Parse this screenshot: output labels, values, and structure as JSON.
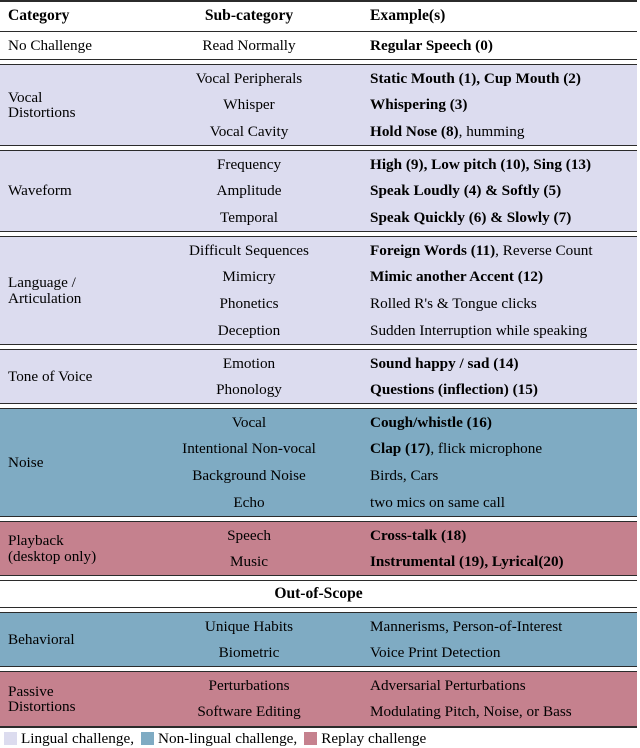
{
  "table": {
    "headers": {
      "category": "Category",
      "subcategory": "Sub-category",
      "examples": "Example(s)"
    },
    "scope_divider": "Out-of-Scope",
    "groups": [
      {
        "id": "no-challenge",
        "band": "white",
        "category": [
          "No Challenge"
        ],
        "rows": [
          {
            "sub": "Read Normally",
            "example_bold": "Regular Speech (0)",
            "example_rest": ""
          }
        ]
      },
      {
        "id": "vocal-distortions",
        "band": "lilac",
        "category": [
          "Vocal",
          "Distortions"
        ],
        "rows": [
          {
            "sub": "Vocal Peripherals",
            "example_bold": "Static Mouth (1), Cup Mouth (2)",
            "example_rest": ""
          },
          {
            "sub": "Whisper",
            "example_bold": "Whispering (3)",
            "example_rest": ""
          },
          {
            "sub": "Vocal Cavity",
            "example_bold": "Hold Nose (8)",
            "example_rest": ", humming"
          }
        ]
      },
      {
        "id": "waveform",
        "band": "lilac",
        "category": [
          "Waveform"
        ],
        "rows": [
          {
            "sub": "Frequency",
            "example_bold": "High (9), Low pitch (10), Sing (13)",
            "example_rest": ""
          },
          {
            "sub": "Amplitude",
            "example_bold": "Speak Loudly (4) & Softly (5)",
            "example_rest": ""
          },
          {
            "sub": "Temporal",
            "example_bold": "Speak Quickly (6) & Slowly (7)",
            "example_rest": ""
          }
        ]
      },
      {
        "id": "language-articulation",
        "band": "lilac",
        "category": [
          "Language /",
          "Articulation"
        ],
        "rows": [
          {
            "sub": "Difficult Sequences",
            "example_bold": "Foreign Words (11)",
            "example_rest": ", Reverse Count"
          },
          {
            "sub": "Mimicry",
            "example_bold": "Mimic another Accent (12)",
            "example_rest": ""
          },
          {
            "sub": "Phonetics",
            "example_bold": "",
            "example_rest": "Rolled R's & Tongue clicks"
          },
          {
            "sub": "Deception",
            "example_bold": "",
            "example_rest": "Sudden Interruption while speaking"
          }
        ]
      },
      {
        "id": "tone-of-voice",
        "band": "lilac",
        "category": [
          "Tone of Voice"
        ],
        "rows": [
          {
            "sub": "Emotion",
            "example_bold": "Sound happy / sad (14)",
            "example_rest": ""
          },
          {
            "sub": "Phonology",
            "example_bold": "Questions (inflection) (15)",
            "example_rest": ""
          }
        ]
      },
      {
        "id": "noise",
        "band": "teal",
        "category": [
          "Noise"
        ],
        "rows": [
          {
            "sub": "Vocal",
            "example_bold": "Cough/whistle (16)",
            "example_rest": ""
          },
          {
            "sub": "Intentional Non-vocal",
            "example_bold": "Clap (17)",
            "example_rest": ", flick microphone"
          },
          {
            "sub": "Background Noise",
            "example_bold": "",
            "example_rest": "Birds, Cars"
          },
          {
            "sub": "Echo",
            "example_bold": "",
            "example_rest": "two mics on same call"
          }
        ]
      },
      {
        "id": "playback",
        "band": "rose",
        "category": [
          "Playback",
          "(desktop only)"
        ],
        "rows": [
          {
            "sub": "Speech",
            "example_bold": "Cross-talk (18)",
            "example_rest": ""
          },
          {
            "sub": "Music",
            "example_bold": "Instrumental (19), Lyrical(20)",
            "example_rest": ""
          }
        ]
      },
      {
        "id": "behavioral",
        "band": "teal",
        "category": [
          "Behavioral"
        ],
        "rows": [
          {
            "sub": "Unique Habits",
            "example_bold": "",
            "example_rest": "Mannerisms, Person-of-Interest"
          },
          {
            "sub": "Biometric",
            "example_bold": "",
            "example_rest": "Voice Print Detection"
          }
        ]
      },
      {
        "id": "passive-distortions",
        "band": "rose",
        "category": [
          "Passive",
          "Distortions"
        ],
        "rows": [
          {
            "sub": "Perturbations",
            "example_bold": "",
            "example_rest": "Adversarial Perturbations"
          },
          {
            "sub": "Software Editing",
            "example_bold": "",
            "example_rest": "Modulating Pitch, Noise, or Bass"
          }
        ]
      }
    ]
  },
  "legend": {
    "items": [
      {
        "swatch": "lilac",
        "label": "Lingual challenge,",
        "color": "#dcdcef"
      },
      {
        "swatch": "teal",
        "label": "Non-lingual challenge,",
        "color": "#7fabc3"
      },
      {
        "swatch": "rose",
        "label": "Replay challenge",
        "color": "#c5818e"
      }
    ]
  },
  "colors": {
    "lilac": "#dcdcef",
    "teal": "#7fabc3",
    "rose": "#c5818e",
    "rule": "#2b2b2b",
    "text": "#000000",
    "background": "#ffffff"
  }
}
